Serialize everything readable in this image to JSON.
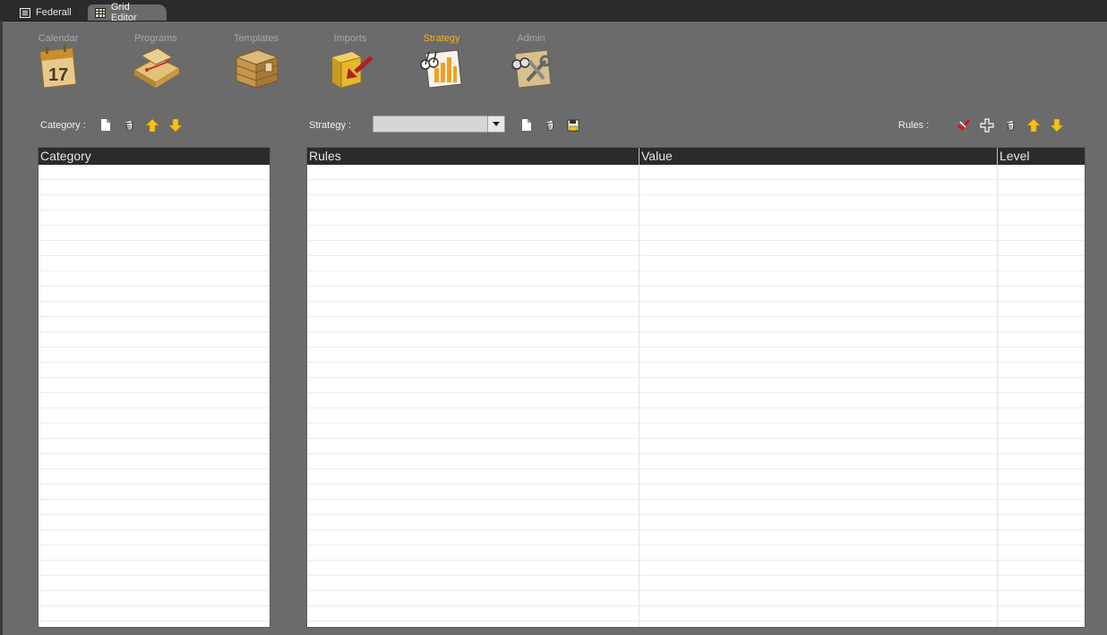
{
  "tabs": [
    {
      "label": "Federall",
      "icon": "window-icon"
    },
    {
      "label": "Grid Editor",
      "icon": "grid-icon"
    }
  ],
  "nav": [
    {
      "label": "Calendar",
      "icon": "calendar-icon",
      "day": "17"
    },
    {
      "label": "Programs",
      "icon": "programs-icon"
    },
    {
      "label": "Templates",
      "icon": "templates-icon"
    },
    {
      "label": "Imports",
      "icon": "imports-icon"
    },
    {
      "label": "Strategy",
      "icon": "strategy-icon",
      "active": true
    },
    {
      "label": "Admin",
      "icon": "admin-icon"
    }
  ],
  "category_toolbar": {
    "label": "Category :"
  },
  "strategy_toolbar": {
    "label": "Strategy :",
    "selected": ""
  },
  "rules_toolbar": {
    "label": "Rules :"
  },
  "category_grid": {
    "columns": [
      "Category"
    ]
  },
  "rules_grid": {
    "columns": [
      "Rules",
      "Value",
      "Level"
    ]
  },
  "colors": {
    "accent": "#f2b21e",
    "background": "#6b6b6b",
    "header": "#2b2b2b"
  }
}
